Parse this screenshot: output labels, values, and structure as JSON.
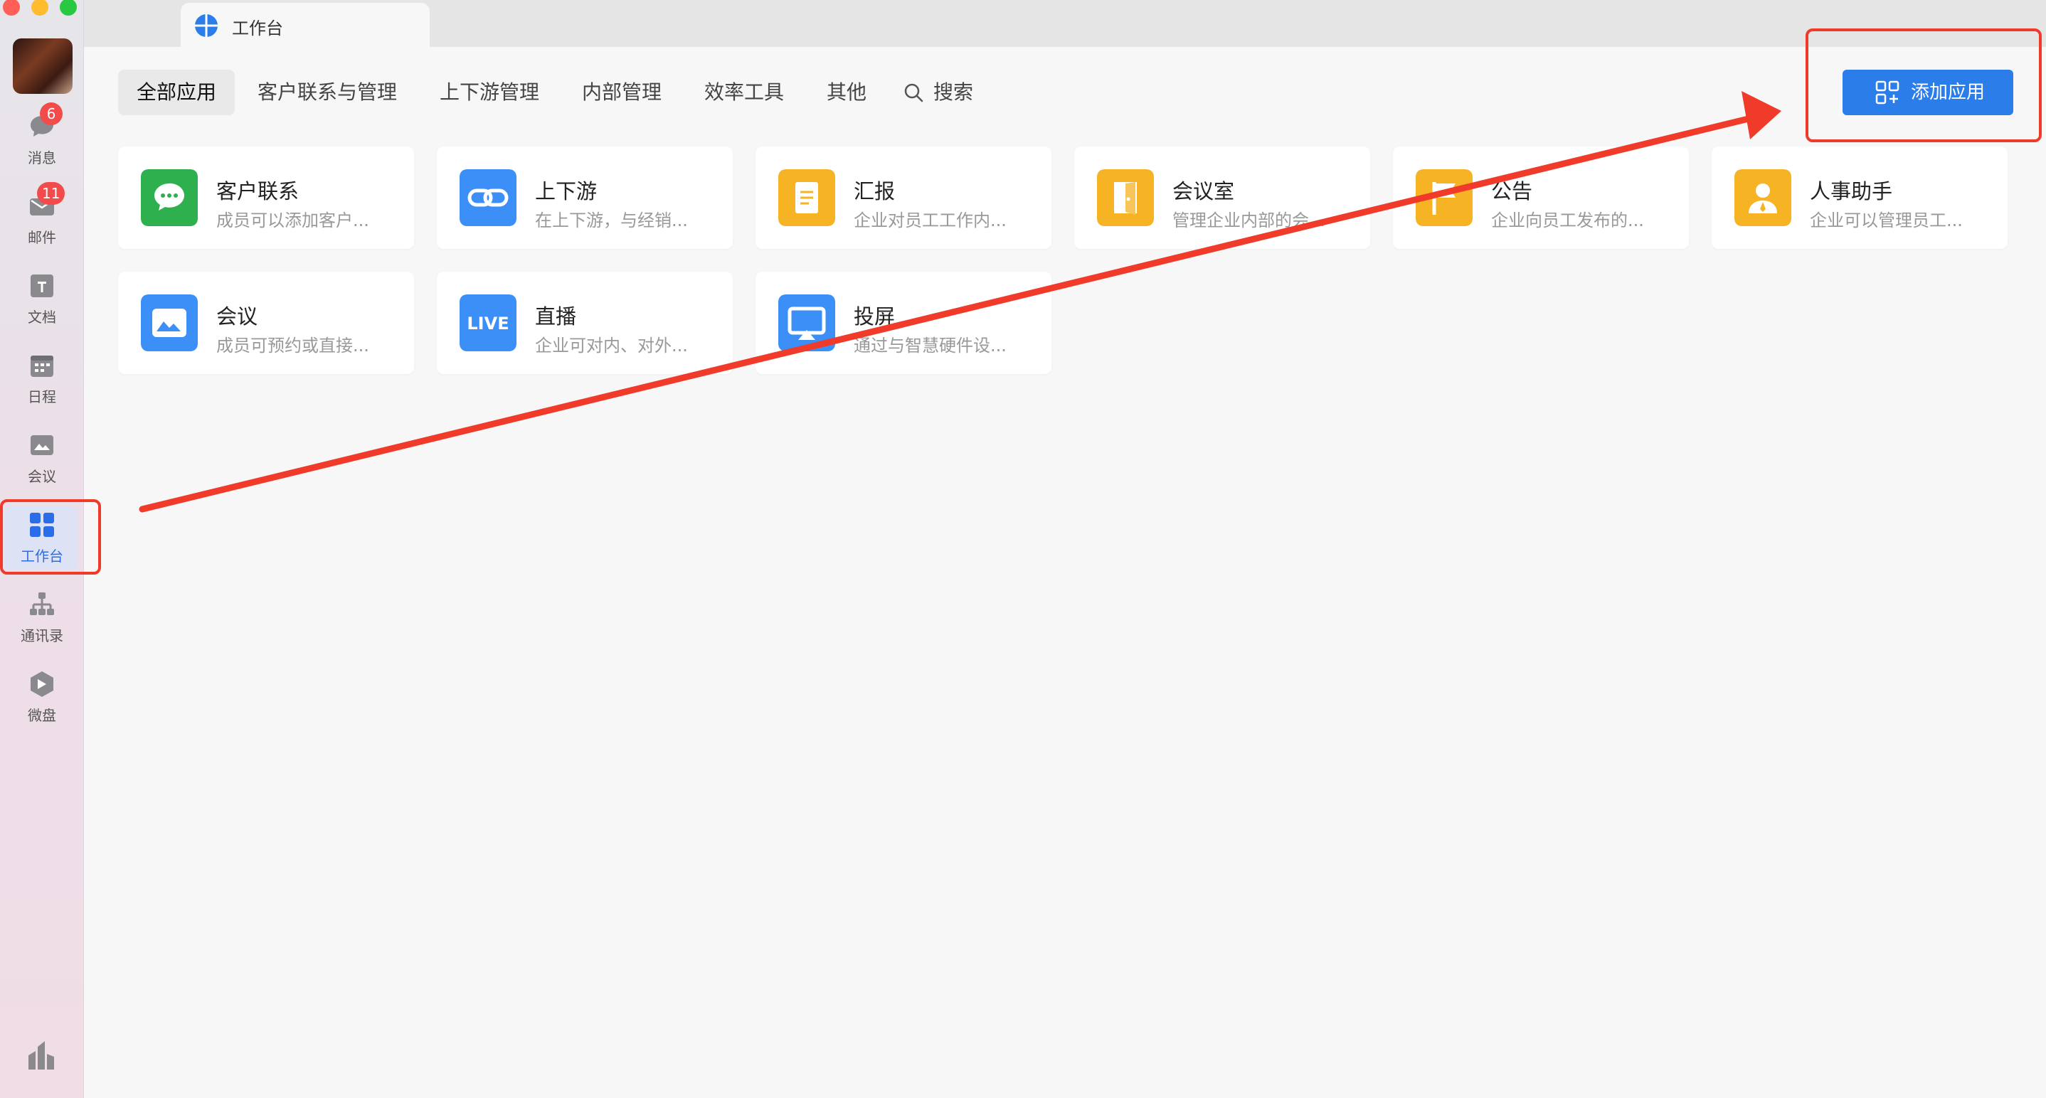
{
  "window": {
    "tab_title": "工作台"
  },
  "sidebar": {
    "items": [
      {
        "label": "消息",
        "badge": "6",
        "icon": "message-icon"
      },
      {
        "label": "邮件",
        "badge": "11",
        "icon": "mail-icon"
      },
      {
        "label": "文档",
        "icon": "document-icon"
      },
      {
        "label": "日程",
        "icon": "calendar-icon"
      },
      {
        "label": "会议",
        "icon": "meeting-icon"
      },
      {
        "label": "工作台",
        "icon": "workbench-icon",
        "active": true
      },
      {
        "label": "通讯录",
        "icon": "contacts-icon"
      },
      {
        "label": "微盘",
        "icon": "drive-icon"
      }
    ]
  },
  "categories": {
    "all": "全部应用",
    "customer": "客户联系与管理",
    "upstream": "上下游管理",
    "internal": "内部管理",
    "efficiency": "效率工具",
    "other": "其他",
    "search": "搜索"
  },
  "toolbar": {
    "add_app": "添加应用"
  },
  "apps": [
    {
      "name": "客户联系",
      "desc": "成员可以添加客户...",
      "icon": "customer-contact-icon",
      "color": "#2fb04f"
    },
    {
      "name": "上下游",
      "desc": "在上下游，与经销...",
      "icon": "upstream-link-icon",
      "color": "#3b8ff6"
    },
    {
      "name": "汇报",
      "desc": "企业对员工工作内...",
      "icon": "report-icon",
      "color": "#f6b324"
    },
    {
      "name": "会议室",
      "desc": "管理企业内部的会...",
      "icon": "meeting-room-door-icon",
      "color": "#f6b324"
    },
    {
      "name": "公告",
      "desc": "企业向员工发布的...",
      "icon": "announcement-flag-icon",
      "color": "#f6b324"
    },
    {
      "name": "人事助手",
      "desc": "企业可以管理员工...",
      "icon": "hr-assistant-icon",
      "color": "#f6b324"
    },
    {
      "name": "会议",
      "desc": "成员可预约或直接...",
      "icon": "meeting-icon",
      "color": "#3b8ff6"
    },
    {
      "name": "直播",
      "desc": "企业可对内、对外...",
      "icon": "live-icon",
      "icon_text": "LIVE",
      "color": "#3b8ff6"
    },
    {
      "name": "投屏",
      "desc": "通过与智慧硬件设...",
      "icon": "screen-cast-icon",
      "color": "#3b8ff6"
    }
  ]
}
